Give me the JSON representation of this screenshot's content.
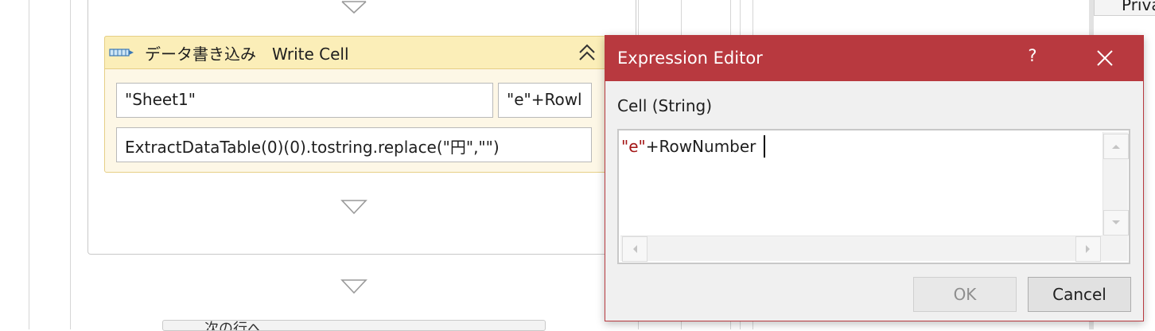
{
  "activity": {
    "title": "データ書き込み　Write Cell",
    "sheet_value": "\"Sheet1\"",
    "cell_value_truncated": "\"e\"+Rowl",
    "value_expression": "ExtractDataTable(0)(0).tostring.replace(\"円\",\"\")",
    "icon": "write-cell-icon"
  },
  "next_activity": {
    "title_partial": "次の行へ"
  },
  "properties_panel": {
    "header_partial": "Priva"
  },
  "dialog": {
    "title": "Expression Editor",
    "help_label": "?",
    "field_label": "Cell (String)",
    "expression_string_part": "\"e\"",
    "expression_rest": "+RowNumber",
    "ok_label": "OK",
    "cancel_label": "Cancel",
    "colors": {
      "titlebar": "#b8393f",
      "string_literal": "#a31515"
    }
  }
}
